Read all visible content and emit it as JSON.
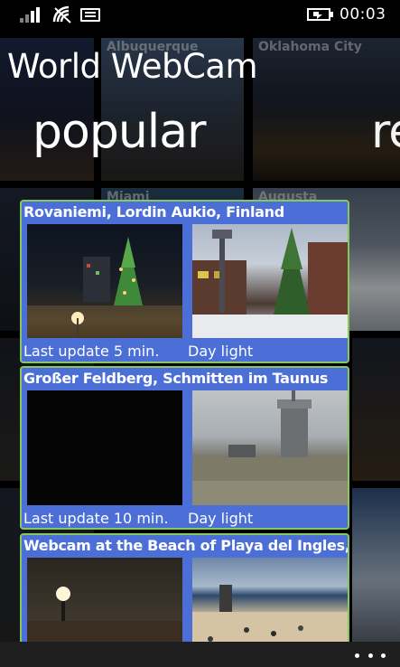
{
  "status_bar": {
    "time": "00:03",
    "icons": [
      "signal-icon",
      "wifi-icon",
      "message-icon",
      "battery-charging-icon"
    ]
  },
  "app": {
    "title": "World WebCam"
  },
  "pivot": {
    "active_label": "popular",
    "next_label": "re"
  },
  "background_tiles": {
    "labels": [
      "Albuquerque",
      "Oklahoma City",
      "Miami",
      "Augusta"
    ]
  },
  "cards": [
    {
      "title": "Rovaniemi, Lordin Aukio, Finland",
      "left_label": "Last update 5 min.",
      "right_label": "Day light"
    },
    {
      "title": "Großer Feldberg, Schmitten im Taunus",
      "left_label": "Last update 10 min.",
      "right_label": "Day light"
    },
    {
      "title": "Webcam at the Beach of Playa del Ingles,",
      "left_label": "",
      "right_label": ""
    }
  ],
  "app_bar": {
    "more_icon": "more-ellipsis-icon"
  },
  "colors": {
    "card_background": "#4b6fd6",
    "card_border": "#87c85d",
    "app_bar": "#1f1f1f"
  }
}
